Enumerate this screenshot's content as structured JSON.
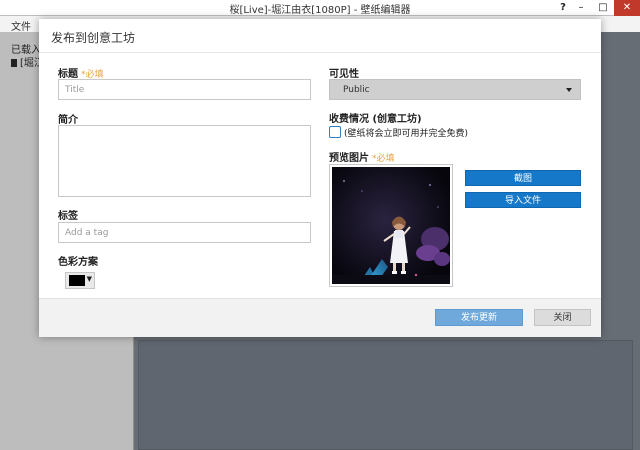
{
  "window": {
    "title": "桜[Live]-堀江由衣[1080P] - 壁纸编辑器",
    "help_label": "?",
    "minimize_label": "–",
    "maximize_label": "□",
    "close_label": "✕"
  },
  "menu": {
    "file_label": "文件"
  },
  "left_panel": {
    "header": "已载入",
    "item_label": "[堀江"
  },
  "dialog": {
    "title": "发布到创意工坊",
    "required_mark": "*必填",
    "title_field": {
      "label": "标题",
      "placeholder": "Title",
      "value": ""
    },
    "description_field": {
      "label": "简介",
      "value": ""
    },
    "tags_field": {
      "label": "标签",
      "placeholder": "Add a tag",
      "value": ""
    },
    "color_scheme": {
      "label": "色彩方案",
      "value_color": "#000000",
      "dropdown_glyph": "▼"
    },
    "visibility": {
      "label": "可见性",
      "selected": "Public"
    },
    "pricing": {
      "label": "收费情况 (创意工坊)",
      "checkbox_label": "(壁纸将会立即可用并完全免费)",
      "checked": false
    },
    "preview": {
      "label": "预览图片",
      "required_mark": "*必填"
    },
    "screenshot_button": "截图",
    "import_file_button": "导入文件",
    "publish_button": "发布更新",
    "close_button": "关闭"
  },
  "colors": {
    "accent_blue": "#1578c9",
    "publish_blue": "#6fa9dc",
    "required_orange": "#e8a33c"
  }
}
